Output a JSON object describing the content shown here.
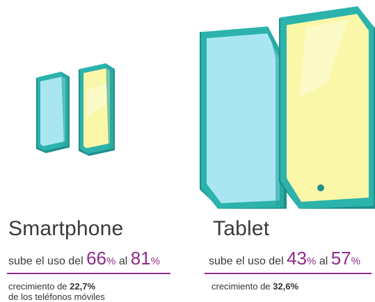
{
  "smartphone": {
    "title": "Smartphone",
    "usage_prefix": "sube el uso del",
    "from_value": "66",
    "connector": "al",
    "to_value": "81",
    "percent_sign": "%",
    "growth_prefix": "crecimiento de",
    "growth_value": "22,7%",
    "growth_suffix": "de los teléfonos móviles"
  },
  "tablet": {
    "title": "Tablet",
    "usage_prefix": "sube el uso del",
    "from_value": "43",
    "connector": "al",
    "to_value": "57",
    "percent_sign": "%",
    "growth_prefix": "crecimiento de",
    "growth_value": "32,6%"
  },
  "colors": {
    "accent": "#8e2c8a",
    "device_frame": "#2bb3ac",
    "device_frame_dark": "#1f8f8a",
    "screen_before": "#a9e6f2",
    "screen_after": "#fbf7a8"
  }
}
